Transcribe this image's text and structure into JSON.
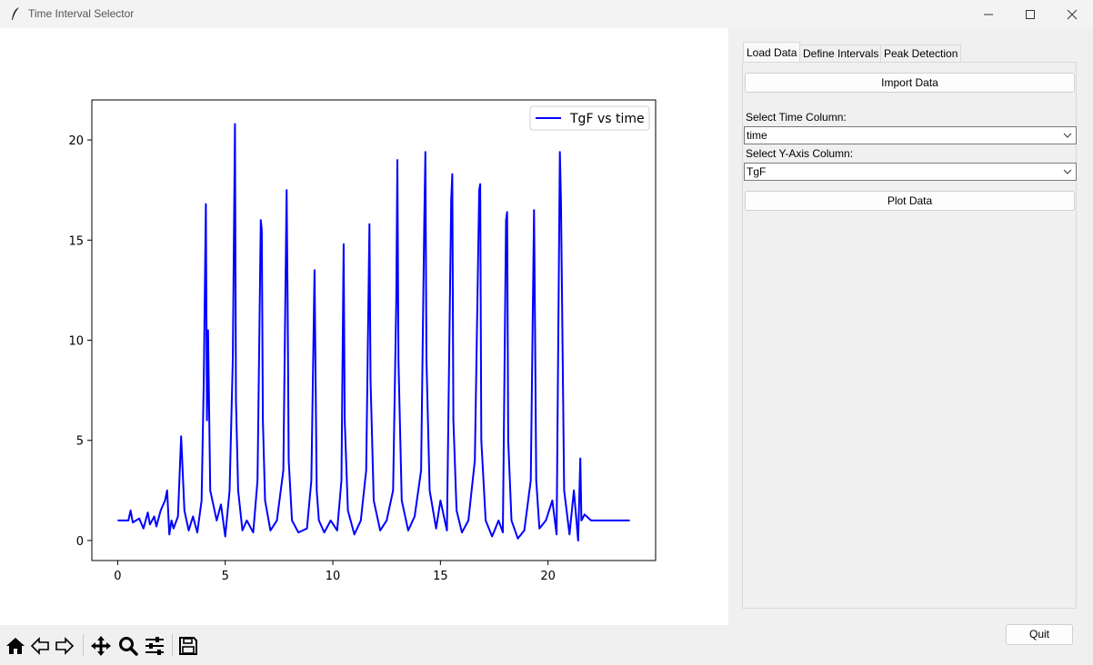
{
  "window": {
    "title": "Time Interval Selector"
  },
  "tabs": [
    {
      "label": "Load Data",
      "active": true
    },
    {
      "label": "Define Intervals",
      "active": false
    },
    {
      "label": "Peak Detection",
      "active": false
    }
  ],
  "load_tab": {
    "import_label": "Import Data",
    "time_column_label": "Select Time Column:",
    "time_column_value": "time",
    "y_column_label": "Select Y-Axis Column:",
    "y_column_value": "TgF",
    "plot_label": "Plot Data"
  },
  "quit_label": "Quit",
  "toolbar_icons": [
    "home-icon",
    "back-icon",
    "forward-icon",
    "pan-icon",
    "zoom-icon",
    "configure-subplots-icon",
    "save-icon"
  ],
  "colors": {
    "series": "#0000ff"
  },
  "chart_data": {
    "type": "line",
    "title": "",
    "xlabel": "",
    "ylabel": "",
    "xlim": [
      -1.2,
      25.0
    ],
    "ylim": [
      -1.0,
      22.0
    ],
    "xticks": [
      0,
      5,
      10,
      15,
      20
    ],
    "yticks": [
      0,
      5,
      10,
      15,
      20
    ],
    "legend": "upper right",
    "series": [
      {
        "name": "TgF vs time",
        "color": "#0000ff",
        "x": [
          0,
          0.5,
          0.6,
          0.7,
          1.0,
          1.2,
          1.4,
          1.5,
          1.7,
          1.8,
          2.0,
          2.2,
          2.3,
          2.4,
          2.5,
          2.6,
          2.8,
          2.95,
          3.1,
          3.3,
          3.5,
          3.7,
          3.9,
          4.0,
          4.1,
          4.15,
          4.2,
          4.3,
          4.6,
          4.8,
          5.0,
          5.2,
          5.35,
          5.45,
          5.5,
          5.6,
          5.8,
          6.0,
          6.3,
          6.5,
          6.65,
          6.7,
          6.75,
          6.85,
          7.1,
          7.4,
          7.7,
          7.85,
          7.9,
          7.95,
          8.1,
          8.4,
          8.8,
          9.0,
          9.15,
          9.2,
          9.25,
          9.35,
          9.6,
          9.9,
          10.2,
          10.4,
          10.5,
          10.55,
          10.7,
          11.0,
          11.3,
          11.55,
          11.7,
          11.75,
          11.9,
          12.2,
          12.5,
          12.8,
          12.95,
          13.0,
          13.05,
          13.2,
          13.5,
          13.8,
          14.1,
          14.25,
          14.3,
          14.35,
          14.5,
          14.8,
          15.0,
          15.3,
          15.5,
          15.55,
          15.6,
          15.75,
          16.0,
          16.3,
          16.6,
          16.8,
          16.85,
          16.9,
          17.1,
          17.4,
          17.7,
          17.9,
          18.05,
          18.1,
          18.15,
          18.3,
          18.6,
          18.9,
          19.2,
          19.35,
          19.4,
          19.45,
          19.6,
          19.9,
          20.2,
          20.4,
          20.55,
          20.6,
          20.65,
          20.75,
          21.0,
          21.2,
          21.4,
          21.5,
          21.55,
          21.7,
          22.0,
          23.0,
          23.8
        ],
        "y": [
          1.0,
          1.0,
          1.5,
          0.9,
          1.1,
          0.6,
          1.4,
          0.8,
          1.2,
          0.7,
          1.5,
          2.0,
          2.5,
          0.3,
          1.0,
          0.6,
          1.2,
          5.2,
          1.5,
          0.5,
          1.2,
          0.4,
          2.0,
          8.0,
          16.8,
          6.0,
          10.5,
          2.5,
          1.0,
          1.8,
          0.2,
          2.5,
          9.0,
          20.8,
          7.0,
          2.5,
          0.5,
          1.0,
          0.4,
          3.0,
          16.0,
          15.5,
          6.0,
          2.0,
          0.5,
          1.0,
          3.5,
          17.5,
          12.0,
          4.0,
          1.0,
          0.4,
          0.6,
          3.0,
          13.5,
          8.0,
          2.5,
          1.0,
          0.4,
          1.0,
          0.5,
          3.0,
          14.8,
          6.0,
          1.5,
          0.3,
          1.0,
          3.5,
          15.8,
          8.0,
          2.0,
          0.5,
          1.0,
          2.5,
          12.0,
          19.0,
          9.0,
          2.0,
          0.5,
          1.2,
          3.5,
          16.0,
          19.4,
          9.0,
          2.5,
          0.6,
          2.0,
          0.5,
          17.0,
          18.3,
          6.0,
          1.5,
          0.4,
          1.0,
          4.0,
          17.5,
          17.8,
          5.0,
          1.0,
          0.2,
          1.0,
          0.4,
          16.0,
          16.4,
          5.0,
          1.0,
          0.1,
          0.5,
          3.0,
          16.5,
          10.0,
          3.0,
          0.6,
          1.0,
          2.0,
          0.3,
          19.4,
          17.0,
          12.0,
          2.5,
          0.3,
          2.5,
          0.0,
          4.1,
          1.0,
          1.3,
          1.0,
          1.0,
          1.0
        ]
      }
    ]
  }
}
